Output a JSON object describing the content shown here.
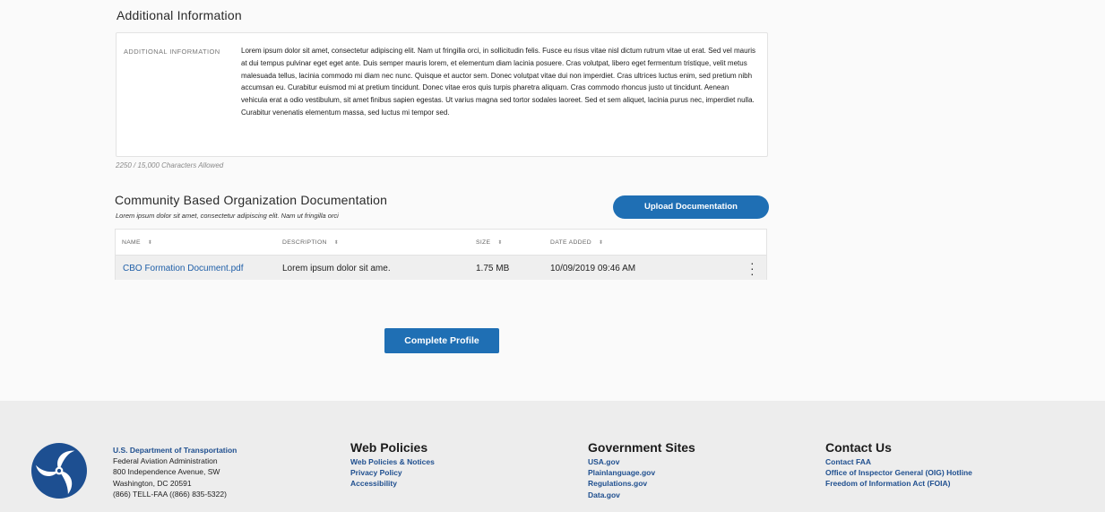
{
  "additional_info": {
    "section_title": "Additional Information",
    "field_label": "ADDITIONAL INFORMATION",
    "text": "Lorem ipsum dolor sit amet, consectetur adipiscing elit. Nam ut fringilla orci, in sollicitudin felis. Fusce eu risus vitae nisl dictum rutrum vitae ut erat. Sed vel mauris at dui tempus pulvinar eget eget ante. Duis semper mauris lorem, et elementum diam lacinia posuere. Cras volutpat, libero eget fermentum tristique, velit metus malesuada tellus, lacinia commodo mi diam nec nunc. Quisque et auctor sem. Donec volutpat vitae dui non imperdiet. Cras ultrices luctus enim, sed pretium nibh accumsan eu. Curabitur euismod mi at pretium tincidunt. Donec vitae eros quis turpis pharetra aliquam. Cras commodo rhoncus justo ut tincidunt. Aenean vehicula erat a odio vestibulum, sit amet finibus sapien egestas. Ut varius magna sed tortor sodales laoreet. Sed et sem aliquet, lacinia purus nec, imperdiet nulla. Curabitur venenatis elementum massa, sed luctus mi tempor sed.",
    "char_count": "2250 / 15,000 Characters Allowed"
  },
  "documentation": {
    "title": "Community Based Organization Documentation",
    "subtitle": "Lorem ipsum dolor sit amet, consectetur adipiscing elit. Nam ut fringilla orci",
    "upload_label": "Upload Documentation",
    "columns": [
      "NAME",
      "DESCRIPTION",
      "SIZE",
      "DATE ADDED"
    ],
    "rows": [
      {
        "name": "CBO Formation Document.pdf",
        "description": "Lorem ipsum dolor sit ame.",
        "size": "1.75 MB",
        "date_added": "10/09/2019 09:46 AM"
      }
    ]
  },
  "complete_label": "Complete Profile",
  "footer": {
    "address": {
      "dept": "U.S. Department of Transportation",
      "lines": [
        "Federal Aviation Administration",
        "800 Independence Avenue, SW",
        "Washington, DC 20591",
        "(866) TELL-FAA ((866) 835-5322)"
      ]
    },
    "columns": [
      {
        "heading": "Web Policies",
        "links": [
          "Web Policies & Notices",
          "Privacy Policy",
          "Accessibility"
        ]
      },
      {
        "heading": "Government Sites",
        "links": [
          "USA.gov",
          "Plainlanguage.gov",
          "Regulations.gov",
          "Data.gov"
        ]
      },
      {
        "heading": "Contact Us",
        "links": [
          "Contact FAA",
          "Office of Inspector General (OIG) Hotline",
          "Freedom of Information Act (FOIA)"
        ]
      }
    ]
  },
  "colors": {
    "primary": "#1f6fb4",
    "link": "#1f5fa8",
    "footer_bg": "#ededed"
  },
  "icons": {
    "logo": "dot-triskelion-logo",
    "sort": "sort-icon",
    "menu": "kebab-menu-icon"
  }
}
